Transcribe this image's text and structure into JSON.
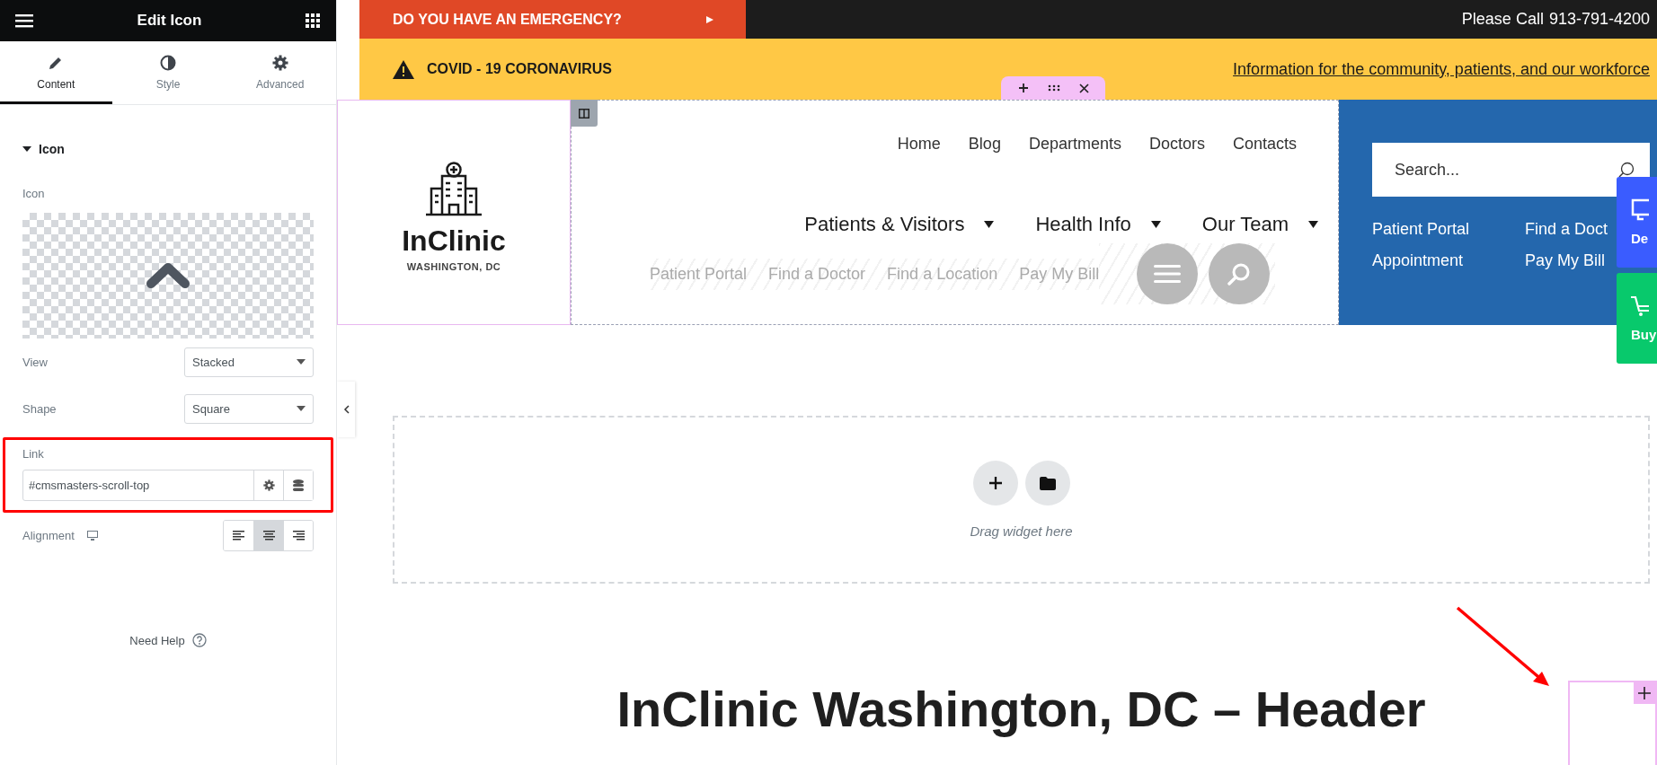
{
  "panel": {
    "title": "Edit Icon",
    "tabs": [
      {
        "label": "Content",
        "kind": "pencil",
        "selected": true
      },
      {
        "label": "Style",
        "kind": "contrast",
        "selected": false
      },
      {
        "label": "Advanced",
        "kind": "gear",
        "selected": false
      }
    ],
    "section": {
      "title": "Icon",
      "expanded": true
    },
    "icon_label": "Icon",
    "fields": [
      {
        "label": "View",
        "value": "Stacked"
      },
      {
        "label": "Shape",
        "value": "Square"
      }
    ],
    "link": {
      "label": "Link",
      "value": "#cmsmasters-scroll-top"
    },
    "alignment": {
      "label": "Alignment",
      "options": [
        {
          "kind": "left",
          "selected": false
        },
        {
          "kind": "center",
          "selected": true
        },
        {
          "kind": "right",
          "selected": false
        }
      ]
    },
    "help": "Need Help"
  },
  "emergency": {
    "text": "DO YOU HAVE AN EMERGENCY?",
    "call_label": "Please Call",
    "phone": "913-791-4200"
  },
  "covid": {
    "title": "COVID - 19 CORONAVIRUS",
    "link": "Information for the community, patients, and our workforce"
  },
  "logo": {
    "name": "InClinic",
    "location": "WASHINGTON, DC"
  },
  "top_nav": [
    "Home",
    "Blog",
    "Departments",
    "Doctors",
    "Contacts"
  ],
  "main_nav": [
    "Patients & Visitors",
    "Health Info",
    "Our Team"
  ],
  "quick_links": [
    "Patient Portal",
    "Find a Doctor",
    "Find a Location",
    "Pay My Bill"
  ],
  "search": {
    "placeholder": "Search..."
  },
  "blue_links": [
    "Patient Portal",
    "Find a Doct",
    "Appointment",
    "Pay My Bill"
  ],
  "side_buttons": [
    {
      "label": "De",
      "kind": "demo"
    },
    {
      "label": "Buy",
      "kind": "buy"
    }
  ],
  "drop_zone": {
    "hint": "Drag widget here"
  },
  "heading": "InClinic Washington, DC – Header"
}
